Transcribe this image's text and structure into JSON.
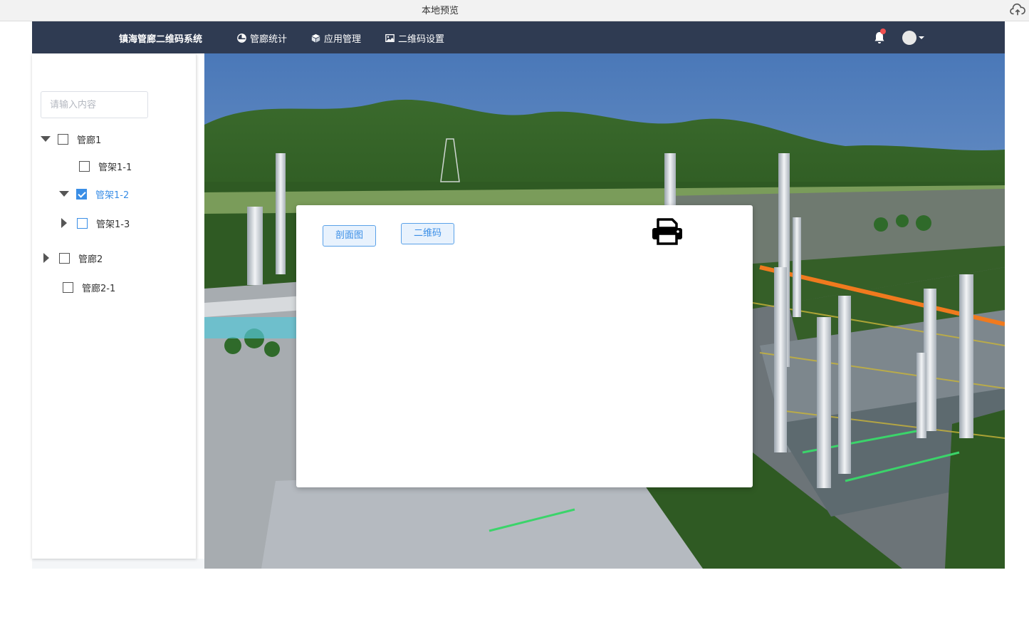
{
  "preview_bar": {
    "title": "本地预览",
    "upload_icon": "cloud-upload-icon"
  },
  "navbar": {
    "app_title": "镇海管廊二维码系统",
    "items": [
      {
        "label": "管廊统计",
        "icon": "pie-chart-icon"
      },
      {
        "label": "应用管理",
        "icon": "cube-icon"
      },
      {
        "label": "二维码设置",
        "icon": "image-icon"
      }
    ],
    "bell_icon": "bell-icon",
    "has_notification": true,
    "avatar_icon": "avatar"
  },
  "sidebar": {
    "search": {
      "placeholder": "请输入内容",
      "value": ""
    },
    "tree": [
      {
        "label": "管廊1",
        "expanded": true,
        "checked": false
      },
      {
        "label": "管架1-1",
        "checked": false
      },
      {
        "label": "管架1-2",
        "expanded": true,
        "checked": true
      },
      {
        "label": "管架1-3",
        "expanded": false,
        "checked": false
      },
      {
        "label": "管廊2",
        "expanded": false,
        "checked": false
      },
      {
        "label": "管廊2-1",
        "checked": false
      }
    ]
  },
  "dialog": {
    "buttons": {
      "section_view": "剖面图",
      "qrcode": "二维码"
    },
    "print_icon": "printer-icon"
  },
  "colors": {
    "navbar": "#2f3b52",
    "accent": "#3a8ee6",
    "notification": "#f05050"
  }
}
